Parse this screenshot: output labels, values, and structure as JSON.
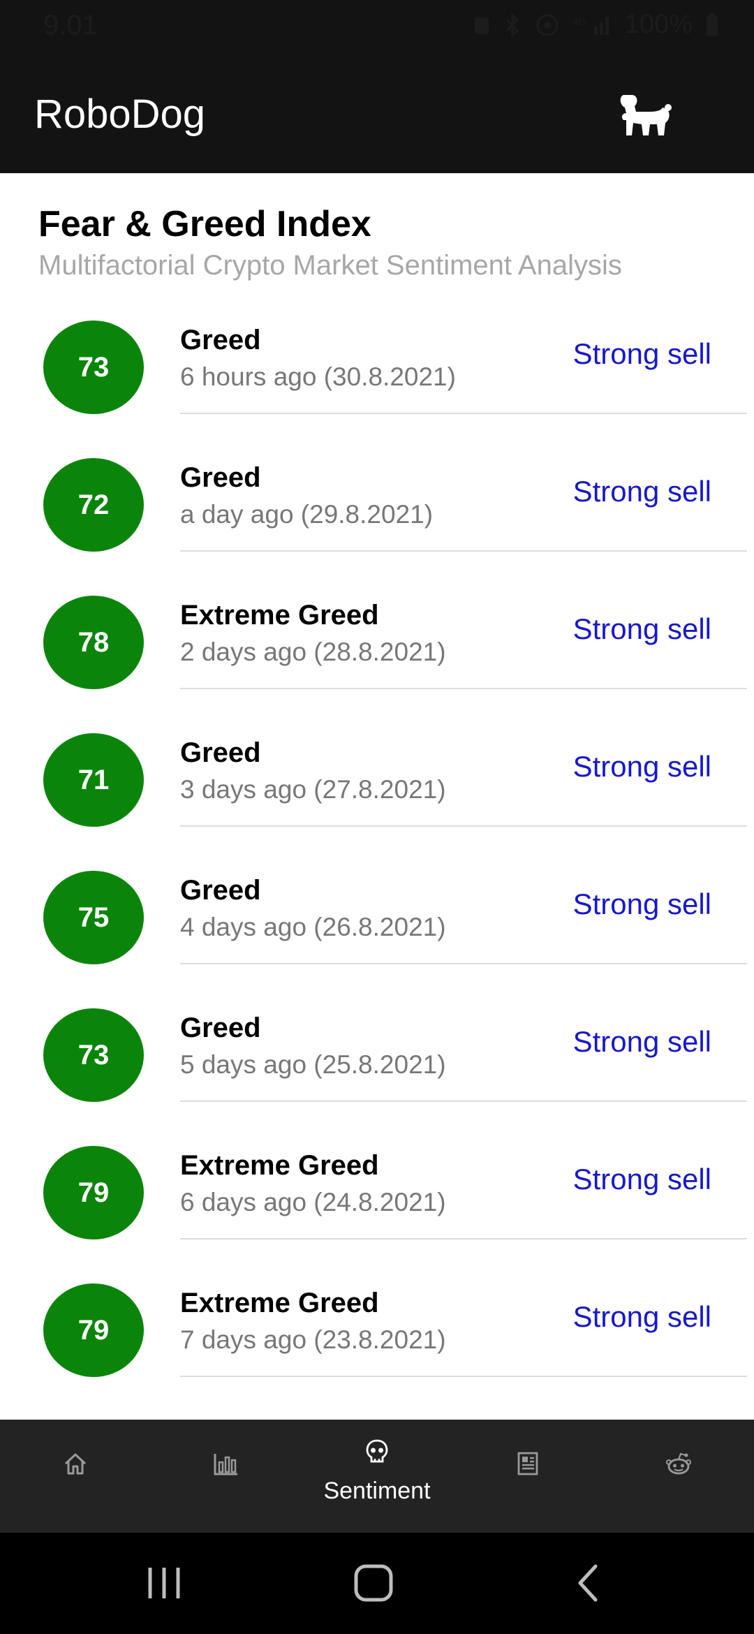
{
  "status_bar": {
    "time": "9.01",
    "battery": "100%"
  },
  "app_bar": {
    "title": "RoboDog",
    "logo_icon": "dog-icon"
  },
  "page": {
    "title": "Fear & Greed Index",
    "subtitle": "Multifactorial Crypto Market Sentiment Analysis"
  },
  "entries": [
    {
      "value": "73",
      "label": "Greed",
      "time": "6 hours ago (30.8.2021)",
      "action": "Strong sell"
    },
    {
      "value": "72",
      "label": "Greed",
      "time": "a day ago (29.8.2021)",
      "action": "Strong sell"
    },
    {
      "value": "78",
      "label": "Extreme Greed",
      "time": "2 days ago (28.8.2021)",
      "action": "Strong sell"
    },
    {
      "value": "71",
      "label": "Greed",
      "time": "3 days ago (27.8.2021)",
      "action": "Strong sell"
    },
    {
      "value": "75",
      "label": "Greed",
      "time": "4 days ago (26.8.2021)",
      "action": "Strong sell"
    },
    {
      "value": "73",
      "label": "Greed",
      "time": "5 days ago (25.8.2021)",
      "action": "Strong sell"
    },
    {
      "value": "79",
      "label": "Extreme Greed",
      "time": "6 days ago (24.8.2021)",
      "action": "Strong sell"
    },
    {
      "value": "79",
      "label": "Extreme Greed",
      "time": "7 days ago (23.8.2021)",
      "action": "Strong sell"
    }
  ],
  "bottom_nav": {
    "items": [
      {
        "icon": "home-icon",
        "label": ""
      },
      {
        "icon": "bar-chart-icon",
        "label": ""
      },
      {
        "icon": "skull-icon",
        "label": "Sentiment",
        "active": true
      },
      {
        "icon": "news-icon",
        "label": ""
      },
      {
        "icon": "reddit-icon",
        "label": ""
      }
    ]
  },
  "colors": {
    "badge_green": "#0a850a",
    "action_blue": "#1818c8",
    "bar_dark": "#131313"
  }
}
